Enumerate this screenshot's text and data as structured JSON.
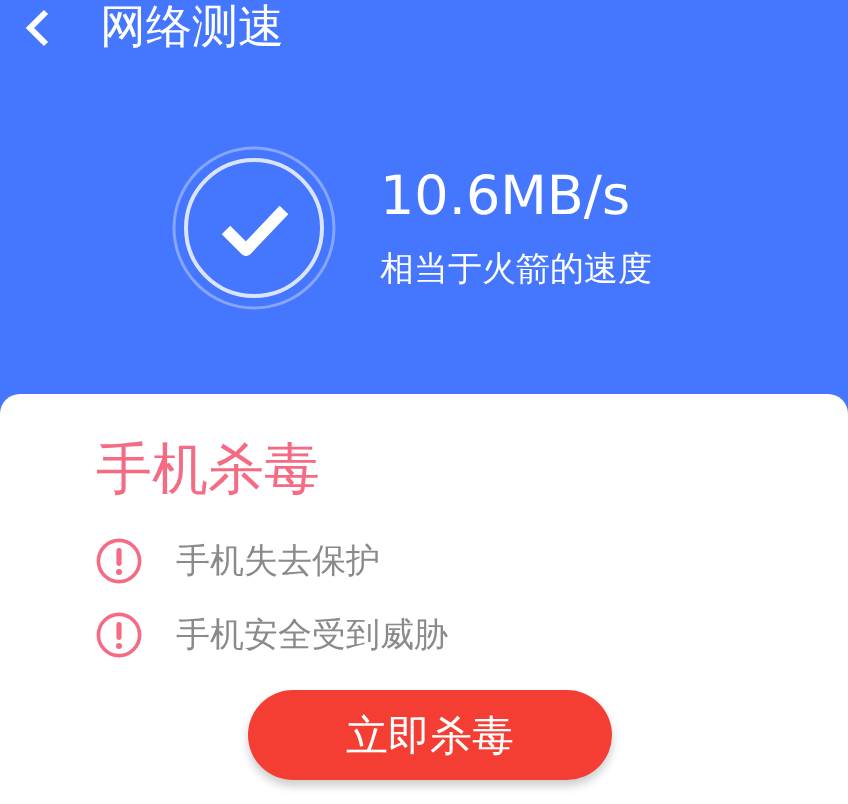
{
  "header": {
    "title": "网络测速"
  },
  "result": {
    "speed": "10.6MB/s",
    "comparison": "相当于火箭的速度"
  },
  "card": {
    "title": "手机杀毒",
    "warnings": [
      {
        "text": "手机失去保护"
      },
      {
        "text": "手机安全受到威胁"
      }
    ],
    "button": "立即杀毒"
  }
}
